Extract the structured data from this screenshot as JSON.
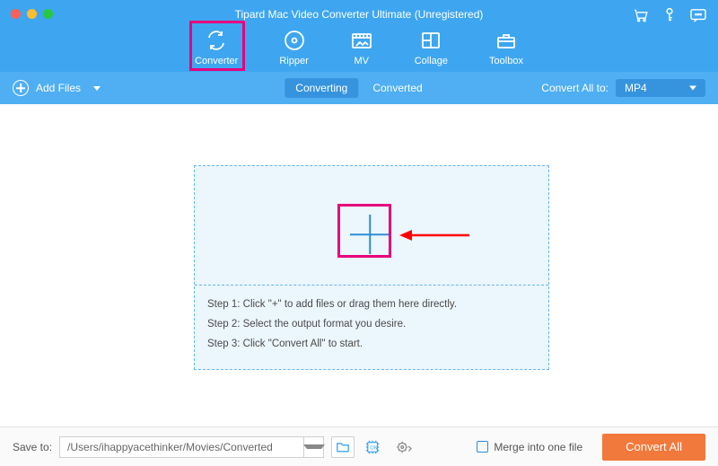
{
  "window": {
    "title": "Tipard Mac Video Converter Ultimate (Unregistered)"
  },
  "header_icons": {
    "cart": "cart-icon",
    "key": "key-icon",
    "feedback": "feedback-icon"
  },
  "tabs": [
    {
      "id": "converter",
      "label": "Converter",
      "icon": "convert-icon",
      "active": true
    },
    {
      "id": "ripper",
      "label": "Ripper",
      "icon": "disc-icon"
    },
    {
      "id": "mv",
      "label": "MV",
      "icon": "mv-icon"
    },
    {
      "id": "collage",
      "label": "Collage",
      "icon": "collage-icon"
    },
    {
      "id": "toolbox",
      "label": "Toolbox",
      "icon": "toolbox-icon"
    }
  ],
  "subbar": {
    "add_files": "Add Files",
    "converting": "Converting",
    "converted": "Converted",
    "convert_all_to": "Convert All to:",
    "format": "MP4"
  },
  "dropzone": {
    "step1": "Step 1: Click \"+\" to add files or drag them here directly.",
    "step2": "Step 2: Select the output format you desire.",
    "step3": "Step 3: Click \"Convert All\" to start."
  },
  "footer": {
    "save_to_label": "Save to:",
    "save_path": "/Users/ihappyacethinker/Movies/Converted",
    "merge_label": "Merge into one file",
    "convert_all": "Convert All"
  },
  "annotations": {
    "highlight_color": "#e6007e",
    "arrow_color": "#ff0000"
  }
}
